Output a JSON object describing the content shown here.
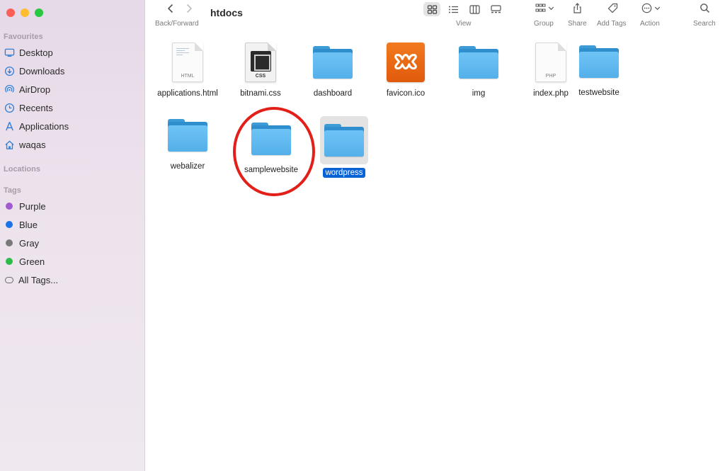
{
  "window": {
    "title": "htdocs"
  },
  "toolbar": {
    "back_forward_label": "Back/Forward",
    "view_label": "View",
    "group_label": "Group",
    "share_label": "Share",
    "add_tags_label": "Add Tags",
    "action_label": "Action",
    "search_label": "Search"
  },
  "sidebar": {
    "favourites_heading": "Favourites",
    "favourites": [
      {
        "label": "Desktop",
        "icon": "desktop-icon"
      },
      {
        "label": "Downloads",
        "icon": "downloads-icon"
      },
      {
        "label": "AirDrop",
        "icon": "airdrop-icon"
      },
      {
        "label": "Recents",
        "icon": "recents-icon"
      },
      {
        "label": "Applications",
        "icon": "applications-icon"
      },
      {
        "label": "waqas",
        "icon": "home-icon"
      }
    ],
    "locations_heading": "Locations",
    "tags_heading": "Tags",
    "tags": [
      {
        "label": "Purple",
        "color": "#a05bd0"
      },
      {
        "label": "Blue",
        "color": "#1a73e8"
      },
      {
        "label": "Gray",
        "color": "#7a7a7a"
      },
      {
        "label": "Green",
        "color": "#2dbb4a"
      },
      {
        "label": "All Tags...",
        "color": ""
      }
    ]
  },
  "files": [
    {
      "name": "applications.html",
      "kind": "document",
      "ext": "HTML"
    },
    {
      "name": "bitnami.css",
      "kind": "css",
      "ext": "CSS"
    },
    {
      "name": "dashboard",
      "kind": "folder"
    },
    {
      "name": "favicon.ico",
      "kind": "xampp-icon"
    },
    {
      "name": "img",
      "kind": "folder"
    },
    {
      "name": "index.php",
      "kind": "document",
      "ext": "PHP"
    },
    {
      "name": "testwebsite",
      "kind": "folder"
    },
    {
      "name": "webalizer",
      "kind": "folder"
    },
    {
      "name": "samplewebsite",
      "kind": "folder",
      "highlighted": true
    },
    {
      "name": "wordpress",
      "kind": "folder",
      "selected": true
    }
  ],
  "colors": {
    "highlight_ring": "#e21f18",
    "selection": "#0a63d6",
    "folder": "#5ab6ee"
  }
}
